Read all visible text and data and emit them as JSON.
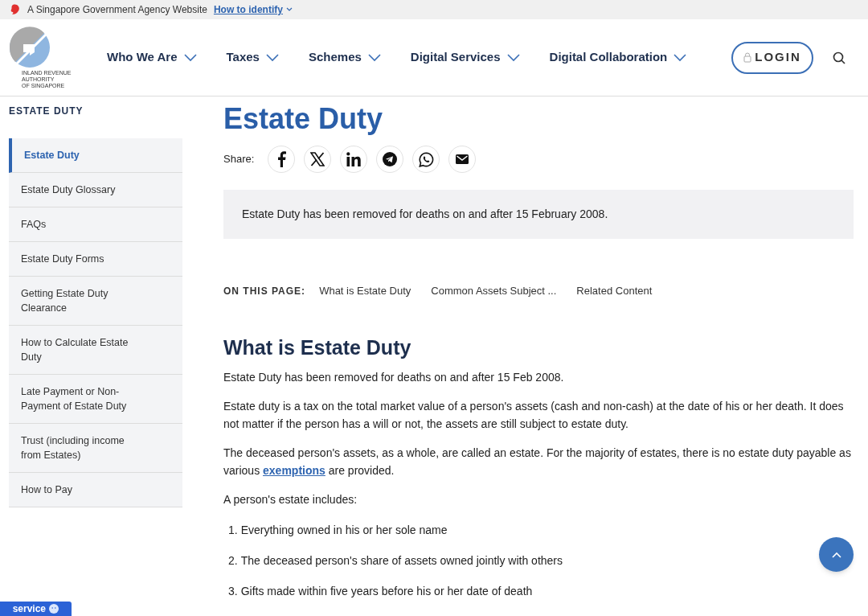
{
  "masthead": {
    "text": "A Singapore Government Agency Website",
    "link": "How to identify"
  },
  "logo": {
    "lines": [
      "INLAND REVENUE",
      "AUTHORITY",
      "OF SINGAPORE"
    ]
  },
  "nav": [
    {
      "label": "Who We Are"
    },
    {
      "label": "Taxes"
    },
    {
      "label": "Schemes"
    },
    {
      "label": "Digital Services"
    },
    {
      "label": "Digital Collaboration"
    }
  ],
  "login": "LOGIN",
  "sidebar": {
    "title": "ESTATE DUTY",
    "items": [
      {
        "label": "Estate Duty",
        "selected": true
      },
      {
        "label": "Estate Duty Glossary",
        "selected": false
      },
      {
        "label": "FAQs",
        "selected": false
      },
      {
        "label": "Estate Duty Forms",
        "selected": false
      },
      {
        "label": "Getting Estate Duty Clearance",
        "selected": false
      },
      {
        "label": "How to Calculate Estate Duty",
        "selected": false
      },
      {
        "label": "Late Payment or Non-Payment of Estate Duty",
        "selected": false
      },
      {
        "label": "Trust (including income from Estates)",
        "selected": false
      },
      {
        "label": "How to Pay",
        "selected": false
      }
    ]
  },
  "page_title": "Estate Duty",
  "share": {
    "label": "Share:",
    "buttons": [
      {
        "kind": "facebook"
      },
      {
        "kind": "x"
      },
      {
        "kind": "linkedin"
      },
      {
        "kind": "telegram"
      },
      {
        "kind": "whatsapp"
      },
      {
        "kind": "email"
      }
    ]
  },
  "notice": "Estate Duty has been removed for deaths on and after 15 February 2008.",
  "on_this_page": {
    "label": "ON THIS PAGE:",
    "links": [
      "What is Estate Duty",
      "Common Assets Subject ...",
      "Related Content"
    ]
  },
  "section": {
    "heading": "What is Estate Duty",
    "paragraphs": [
      {
        "text": "Estate Duty has been removed for deaths on and after 15 Feb 2008."
      },
      {
        "text": "Estate duty is a tax on the total market value of a person's assets (cash and non-cash) at the date of his or her death. It does not matter if the person has a will or not, the assets are still subject to estate duty."
      },
      {
        "text": "The deceased person's assets, as a whole, are called an estate. For the majority of estates, there is no estate duty payable as various ",
        "link": "exemptions",
        "after": " are provided."
      },
      {
        "text": "A person's estate includes:"
      }
    ],
    "list": [
      {
        "num": "1.",
        "text": "Everything owned in his or her sole name"
      },
      {
        "num": "2.",
        "text": "The deceased person's share of assets owned jointly with others"
      },
      {
        "num": "3.",
        "text": "Gifts made within five years before his or her date of death"
      }
    ]
  },
  "feedback_button": "service"
}
